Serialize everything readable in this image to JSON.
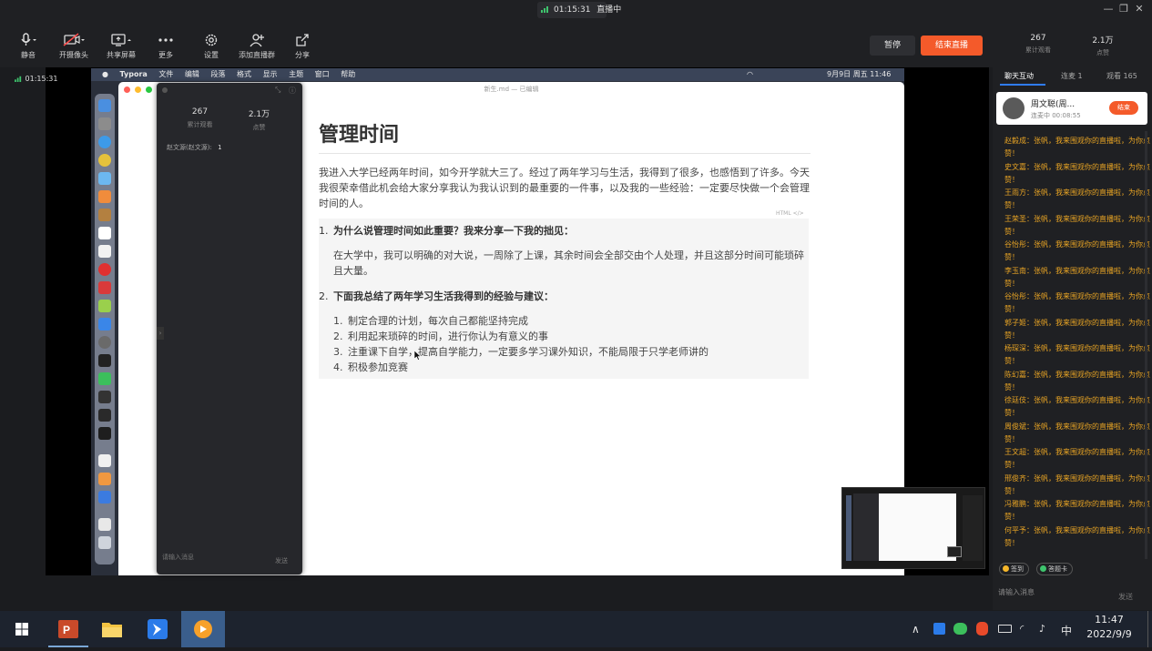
{
  "livestatus": {
    "timer": "01:15:31",
    "status": "直播中"
  },
  "toolbar": {
    "mute": "静音",
    "camera": "开摄像头",
    "share": "共享屏幕",
    "more": "更多",
    "settings": "设置",
    "add_host": "添加直播群",
    "share_link": "分享",
    "pause": "暂停",
    "end": "结束直播",
    "viewers_total_value": "267",
    "viewers_total_label": "累计观看",
    "likes_value": "2.1万",
    "likes_label": "点赞"
  },
  "stage": {
    "timer": "01:15:31"
  },
  "mac_menubar": {
    "apple": "",
    "items": [
      "Typora",
      "文件",
      "编辑",
      "段落",
      "格式",
      "显示",
      "主题",
      "窗口",
      "帮助"
    ],
    "clock": "9月9日 周五  11:46"
  },
  "typora": {
    "file_title": "新生.md — 已编辑",
    "html_tag": "HTML </>",
    "heading": "管理时间",
    "intro": "我进入大学已经两年时间，如今开学就大三了。经过了两年学习与生活，我得到了很多，也感悟到了许多。今天我很荣幸借此机会给大家分享我认为我认识到的最重要的一件事，以及我的一些经验：一定要尽快做一个会管理时间的人。",
    "q1_num": "1.",
    "q1": "为什么说管理时间如此重要？我来分享一下我的拙见：",
    "a1": "在大学中，我可以明确的对大说，一周除了上课，其余时间会全部交由个人处理，并且这部分时间可能琐碎且大量。",
    "q2_num": "2.",
    "q2": "下面我总结了两年学习生活我得到的经验与建议：",
    "list": [
      {
        "num": "1.",
        "text": "制定合理的计划，每次自己都能坚持完成"
      },
      {
        "num": "2.",
        "text": "利用起来琐碎的时间，进行你认为有意义的事"
      },
      {
        "num": "3.",
        "text": "注重课下自学，提高自学能力，一定要多学习课外知识，不能局限于只学老师讲的"
      },
      {
        "num": "4.",
        "text": "积极参加竞赛"
      }
    ]
  },
  "float_panel": {
    "views_value": "267",
    "views_label": "累计观看",
    "likes_value": "2.1万",
    "likes_label": "点赞",
    "user_row_name": "赵文源(赵文源):",
    "user_row_value": "1",
    "input_placeholder": "请输入消息",
    "send": "发送"
  },
  "right_panel": {
    "tabs": [
      "聊天互动",
      "连麦 1",
      "观看 165"
    ],
    "host_name": "周文聪(周...",
    "host_sub": "连麦中 00:08:55",
    "host_action": "结束",
    "messages": [
      {
        "name": "赵毅成：",
        "text": "张帆，我来围观你的直播啦，为你点赞！"
      },
      {
        "name": "史文嘉：",
        "text": "张帆，我来围观你的直播啦，为你点赞！"
      },
      {
        "name": "王雨方：",
        "text": "张帆，我来围观你的直播啦，为你点赞！"
      },
      {
        "name": "王荣圣：",
        "text": "张帆，我来围观你的直播啦，为你点赞！"
      },
      {
        "name": "谷怡彤：",
        "text": "张帆，我来围观你的直播啦，为你点赞！"
      },
      {
        "name": "李玉南：",
        "text": "张帆，我来围观你的直播啦，为你点赞！"
      },
      {
        "name": "谷怡彤：",
        "text": "张帆，我来围观你的直播啦，为你点赞！"
      },
      {
        "name": "郭子姬：",
        "text": "张帆，我来围观你的直播啦，为你点赞！"
      },
      {
        "name": "杨琛深：",
        "text": "张帆，我来围观你的直播啦，为你点赞！"
      },
      {
        "name": "陈幻嘉：",
        "text": "张帆，我来围观你的直播啦，为你点赞！"
      },
      {
        "name": "徐廷伎：",
        "text": "张帆，我来围观你的直播啦，为你点赞！"
      },
      {
        "name": "周俊斌：",
        "text": "张帆，我来围观你的直播啦，为你点赞！"
      },
      {
        "name": "王文超：",
        "text": "张帆，我来围观你的直播啦，为你点赞！"
      },
      {
        "name": "邢俊齐：",
        "text": "张帆，我来围观你的直播啦，为你点赞！"
      },
      {
        "name": "冯雅鹏：",
        "text": "张帆，我来围观你的直播啦，为你点赞！"
      },
      {
        "name": "何平予：",
        "text": "张帆，我来围观你的直播啦，为你点赞！"
      }
    ],
    "chip_signin": "签到",
    "chip_checkin": "答题卡",
    "input_placeholder": "请输入消息",
    "send": "发送"
  },
  "taskbar": {
    "ime": "中",
    "time": "11:47",
    "date": "2022/9/9"
  },
  "colors": {
    "accent": "#f45a2a",
    "live_green": "#3ec46d",
    "chat_name": "#e8a424"
  }
}
